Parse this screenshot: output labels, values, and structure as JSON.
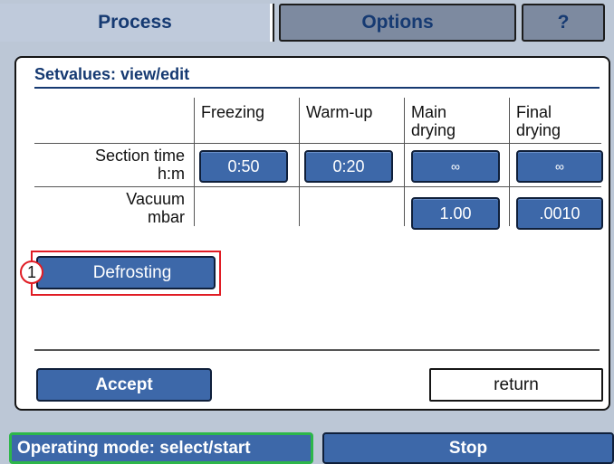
{
  "tabs": {
    "process": "Process",
    "options": "Options",
    "help": "?"
  },
  "dialog": {
    "title": "Setvalues: view/edit",
    "columns": [
      "Freezing",
      "Warm-up",
      "Main\ndrying",
      "Final\ndrying"
    ],
    "rows": [
      {
        "label_line1": "Section time",
        "label_line2": "h:m",
        "values": [
          "0:50",
          "0:20",
          "∞",
          "∞"
        ]
      },
      {
        "label_line1": "Vacuum",
        "label_line2": "mbar",
        "values": [
          "",
          "",
          "1.00",
          ".0010"
        ]
      }
    ],
    "defrost_callout": "1",
    "defrost_label": "Defrosting",
    "accept_label": "Accept",
    "return_label": "return"
  },
  "bottom": {
    "mode_label": "Operating mode: select/start",
    "stop_label": "Stop"
  },
  "colors": {
    "button_blue": "#3d68a9",
    "title_blue": "#163a72",
    "highlight_red": "#e01c24",
    "active_green": "#2db64a"
  }
}
